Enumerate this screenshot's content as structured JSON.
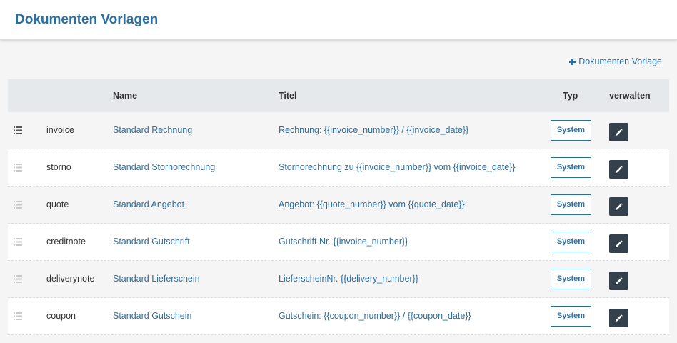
{
  "header": {
    "title": "Dokumenten Vorlagen"
  },
  "toolbar": {
    "add_label": "Dokumenten Vorlage"
  },
  "table": {
    "columns": {
      "name": "Name",
      "title": "Titel",
      "type": "Typ",
      "manage": "verwalten"
    },
    "rows": [
      {
        "key": "invoice",
        "name": "Standard Rechnung",
        "title": "Rechnung: {{invoice_number}} / {{invoice_date}}",
        "type": "System",
        "handle_active": true
      },
      {
        "key": "storno",
        "name": "Standard Stornorechnung",
        "title": "Stornorechnung zu {{invoice_number}} vom {{invoice_date}}",
        "type": "System",
        "handle_active": false
      },
      {
        "key": "quote",
        "name": "Standard Angebot",
        "title": "Angebot: {{quote_number}} vom {{quote_date}}",
        "type": "System",
        "handle_active": false
      },
      {
        "key": "creditnote",
        "name": "Standard Gutschrift",
        "title": "Gutschrift Nr. {{invoice_number}}",
        "type": "System",
        "handle_active": false
      },
      {
        "key": "deliverynote",
        "name": "Standard Lieferschein",
        "title": "LieferscheinNr. {{delivery_number}}",
        "type": "System",
        "handle_active": false
      },
      {
        "key": "coupon",
        "name": "Standard Gutschein",
        "title": "Gutschein: {{coupon_number}} / {{coupon_date}}",
        "type": "System",
        "handle_active": false
      }
    ]
  },
  "icons": {
    "row_handle": "drag-handle-icon",
    "edit": "pencil-icon",
    "add": "plus-icon"
  },
  "colors": {
    "accent": "#2a6fa3",
    "edit_button": "#34404c",
    "header_row": "#e6e9ec"
  }
}
